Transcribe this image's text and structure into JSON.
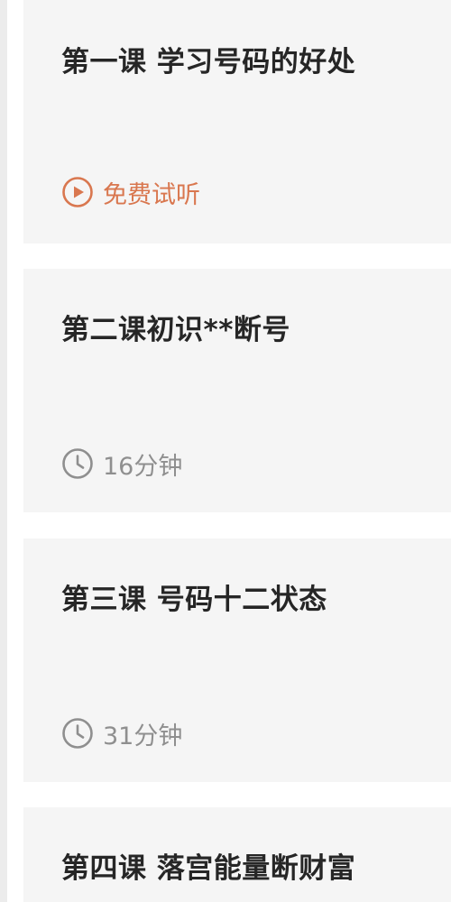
{
  "lessons": [
    {
      "title": "第一课 学习号码的好处",
      "meta_icon": "play-circle-icon",
      "meta_text": "免费试听",
      "meta_color": "#d9774f"
    },
    {
      "title": "第二课初识**断号",
      "meta_icon": "clock-icon",
      "meta_text": "16分钟",
      "meta_color": "#8f8f8f"
    },
    {
      "title": "第三课 号码十二状态",
      "meta_icon": "clock-icon",
      "meta_text": "31分钟",
      "meta_color": "#8f8f8f"
    },
    {
      "title": "第四课 落宫能量断财富"
    }
  ]
}
